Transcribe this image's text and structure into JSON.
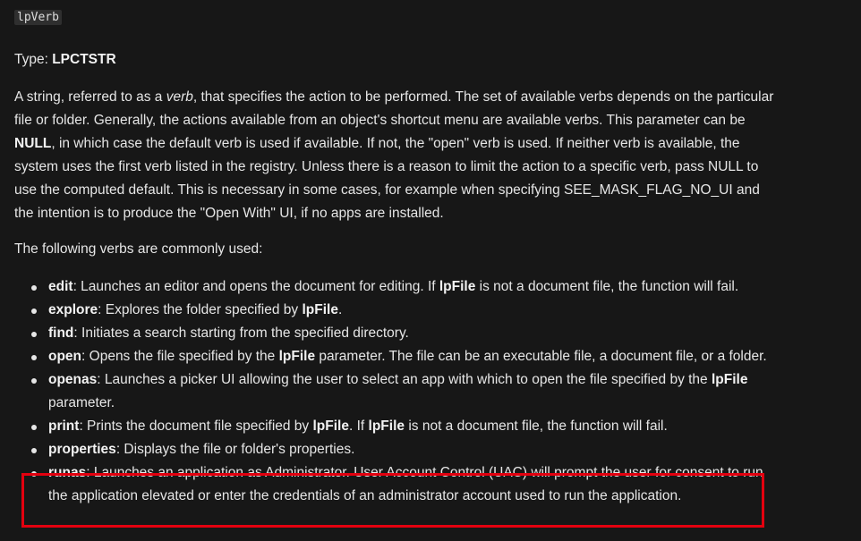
{
  "param": {
    "name": "lpVerb",
    "type_label": "Type: ",
    "type_value": "LPCTSTR"
  },
  "description": {
    "t1": "A string, referred to as a ",
    "t2": "verb",
    "t3": ", that specifies the action to be performed. The set of available verbs depends on the particular file or folder. Generally, the actions available from an object's shortcut menu are available verbs. This parameter can be ",
    "t4": "NULL",
    "t5": ", in which case the default verb is used if available. If not, the \"open\" verb is used. If neither verb is available, the system uses the first verb listed in the registry. Unless there is a reason to limit the action to a specific verb, pass NULL to use the computed default. This is necessary in some cases, for example when specifying SEE_MASK_FLAG_NO_UI and the intention is to produce the \"Open With\" UI, if no apps are installed."
  },
  "intro": "The following verbs are commonly used:",
  "verbs": [
    {
      "name": "edit",
      "t1": ": Launches an editor and opens the document for editing. If ",
      "b1": "lpFile",
      "t2": " is not a document file, the function will fail."
    },
    {
      "name": "explore",
      "t1": ": Explores the folder specified by ",
      "b1": "lpFile",
      "t2": "."
    },
    {
      "name": "find",
      "t1": ": Initiates a search starting from the specified directory."
    },
    {
      "name": "open",
      "t1": ": Opens the file specified by the ",
      "b1": "lpFile",
      "t2": " parameter. The file can be an executable file, a document file, or a folder."
    },
    {
      "name": "openas",
      "t1": ": Launches a picker UI allowing the user to select an app with which to open the file specified by the ",
      "b1": "lpFile",
      "t2": " parameter."
    },
    {
      "name": "print",
      "t1": ": Prints the document file specified by ",
      "b1": "lpFile",
      "t2": ". If ",
      "b2": "lpFile",
      "t3": " is not a document file, the function will fail."
    },
    {
      "name": "properties",
      "t1": ": Displays the file or folder's properties."
    },
    {
      "name": "runas",
      "t1": ": Launches an application as Administrator. User Account Control (UAC) will prompt the user for consent to run the application elevated or enter the credentials of an administrator account used to run the application."
    }
  ],
  "colors": {
    "background": "#171717",
    "text": "#e6e6e6",
    "highlight_border": "#e3000f"
  }
}
